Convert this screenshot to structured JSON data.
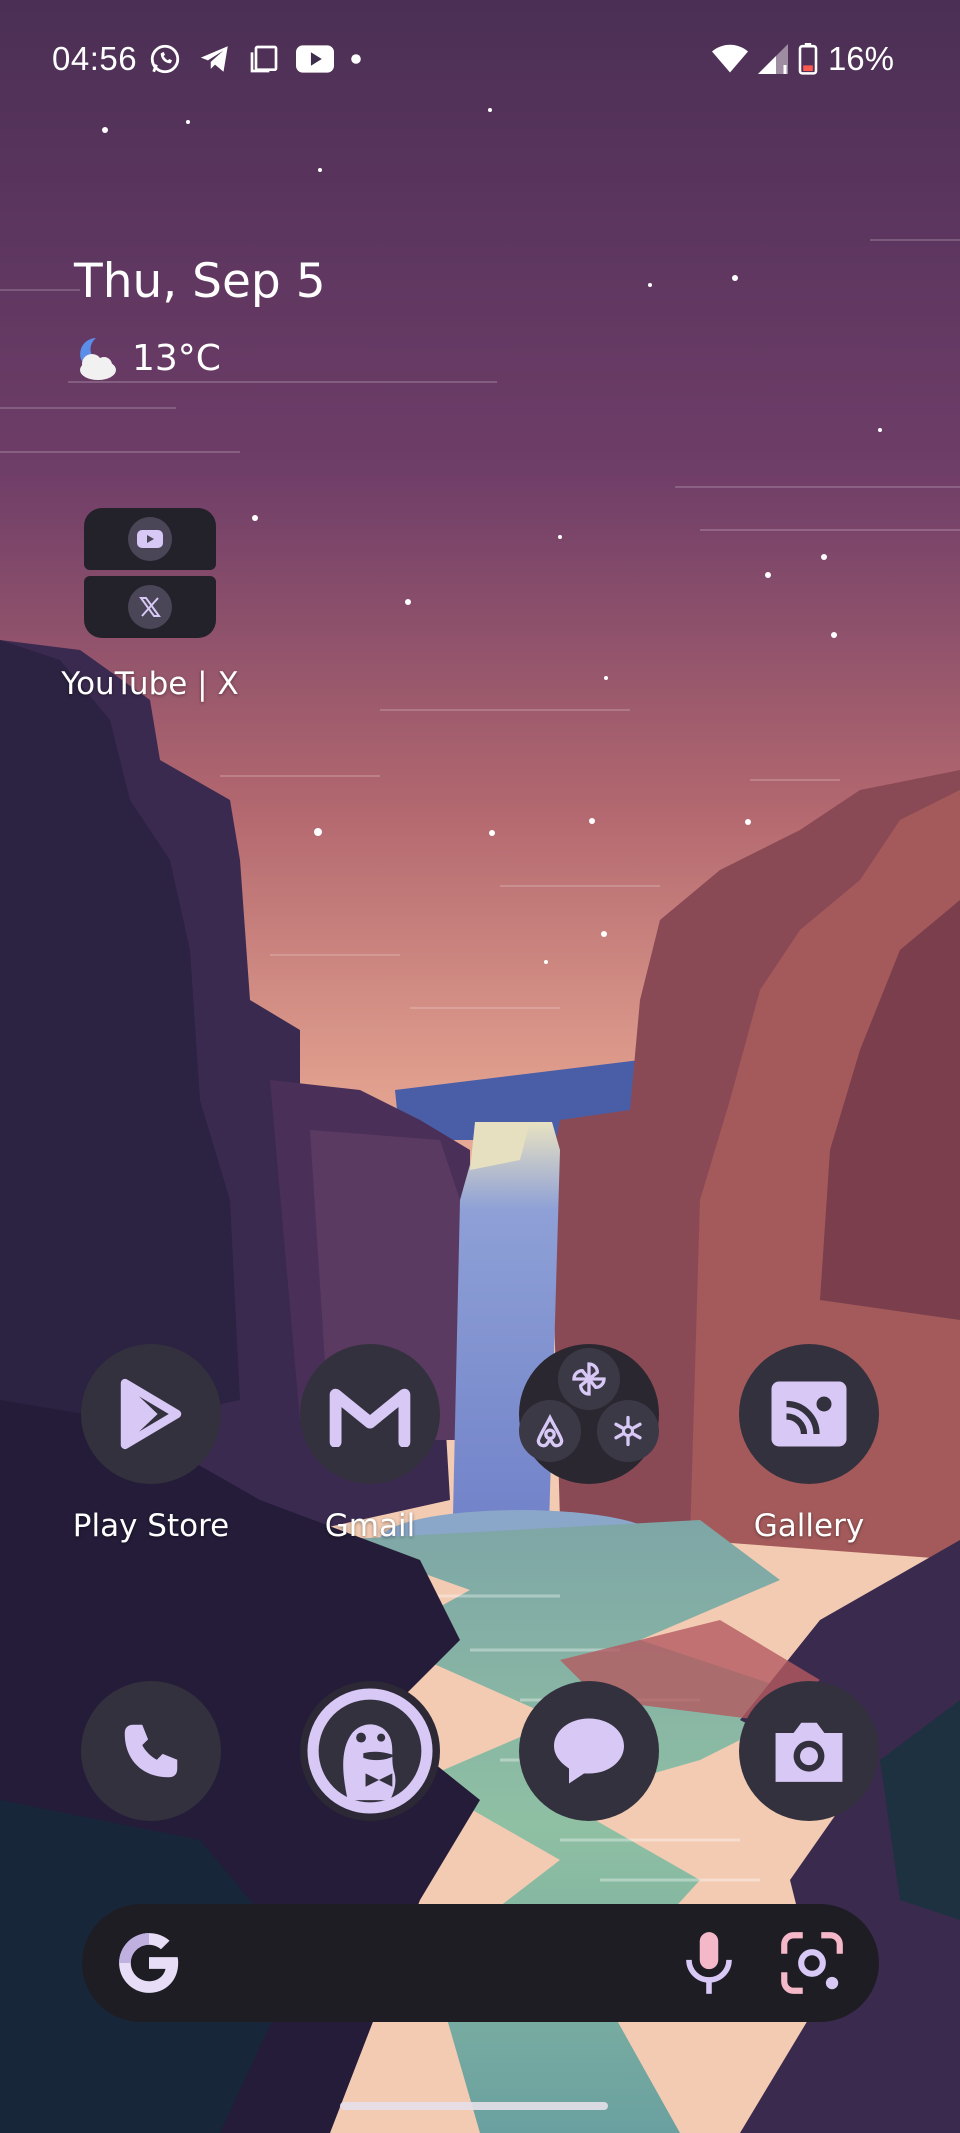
{
  "status_bar": {
    "time": "04:56",
    "notification_icons": [
      "whatsapp-icon",
      "telegram-icon",
      "screen-copy-icon",
      "youtube-icon",
      "dot-icon"
    ],
    "battery_percent": "16%"
  },
  "glance": {
    "date": "Thu, Sep 5",
    "weather_temp": "13°C",
    "weather_icon": "moon-cloud-icon"
  },
  "folder_widget": {
    "label": "YouTube | X",
    "apps": [
      "youtube-icon",
      "x-icon"
    ]
  },
  "home_row": [
    {
      "label": "Play Store",
      "icon": "play-store-icon"
    },
    {
      "label": "Gmail",
      "icon": "gmail-icon"
    },
    {
      "label": "",
      "icon": "app-folder-icon",
      "apps": [
        "pinwheel-icon",
        "airbnb-icon",
        "snowflake-icon"
      ]
    },
    {
      "label": "Gallery",
      "icon": "gallery-icon"
    }
  ],
  "dock": [
    {
      "icon": "phone-icon"
    },
    {
      "icon": "duckduckgo-icon"
    },
    {
      "icon": "messages-icon"
    },
    {
      "icon": "camera-icon"
    }
  ],
  "search_bar": {
    "logo": "google-g-icon",
    "mic": "mic-icon",
    "lens": "lens-icon"
  },
  "colors": {
    "icon_bg": "#34313e",
    "icon_glyph": "#d7c8f5",
    "search_bg": "#1f1d24"
  }
}
